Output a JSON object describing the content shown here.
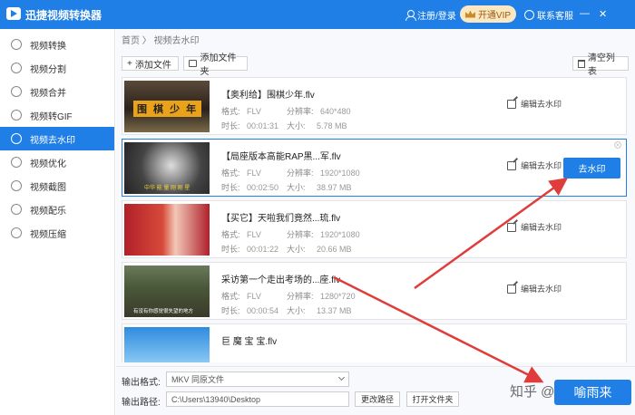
{
  "app": {
    "title": "迅捷视频转换器",
    "login": "注册/登录",
    "vip": "开通VIP",
    "service": "联系客服",
    "win_min": "—",
    "win_close": "✕"
  },
  "sidebar": {
    "items": [
      {
        "label": "视频转换",
        "icon": "film-icon"
      },
      {
        "label": "视频分割",
        "icon": "split-icon"
      },
      {
        "label": "视频合并",
        "icon": "merge-icon"
      },
      {
        "label": "视频转GIF",
        "icon": "gif-icon"
      },
      {
        "label": "视频去水印",
        "icon": "play-icon",
        "active": true
      },
      {
        "label": "视频优化",
        "icon": "optimize-icon"
      },
      {
        "label": "视频截图",
        "icon": "screenshot-icon"
      },
      {
        "label": "视频配乐",
        "icon": "music-icon"
      },
      {
        "label": "视频压缩",
        "icon": "compress-icon"
      }
    ]
  },
  "breadcrumb": "首页 〉 视频去水印",
  "toolbar": {
    "add_file": "添加文件",
    "add_folder": "添加文件夹",
    "clear_list": "清空列表"
  },
  "list_labels": {
    "format": "格式:",
    "resolution": "分辨率:",
    "duration": "时长:",
    "size": "大小:",
    "edit_watermark": "编辑去水印",
    "remove_watermark": "去水印"
  },
  "videos": [
    {
      "name": "【奥利给】围棋少年.flv",
      "format": "FLV",
      "resolution": "640*480",
      "duration": "00:01:31",
      "size": "5.78 MB",
      "thumb_text": "围 棋 少 年"
    },
    {
      "name": "【局座版本高能RAP黑...军.flv",
      "format": "FLV",
      "resolution": "1920*1080",
      "duration": "00:02:50",
      "size": "38.97 MB",
      "thumb_text": "中华 能 量 刚 刚 星",
      "selected": true
    },
    {
      "name": "【买它】天啦我们竟然...琉.flv",
      "format": "FLV",
      "resolution": "1920*1080",
      "duration": "00:01:22",
      "size": "20.66 MB"
    },
    {
      "name": "采访第一个走出考场的...座.flv",
      "format": "FLV",
      "resolution": "1280*720",
      "duration": "00:00:54",
      "size": "13.37 MB",
      "thumb_text": "有没有你感觉很失望的地方"
    },
    {
      "name": "巨 魔 宝 宝.flv"
    }
  ],
  "output": {
    "format_label": "输出格式:",
    "format_value": "MKV  同原文件",
    "path_label": "输出路径:",
    "path_value": "C:\\Users\\13940\\Desktop",
    "change_path": "更改路径",
    "open_folder": "打开文件夹",
    "start": "喻雨来",
    "watermark_text": "知乎 @"
  },
  "colors": {
    "accent": "#1f7fe6",
    "arrow": "#e03c3c",
    "vip_bg": "#fbe8c3"
  }
}
